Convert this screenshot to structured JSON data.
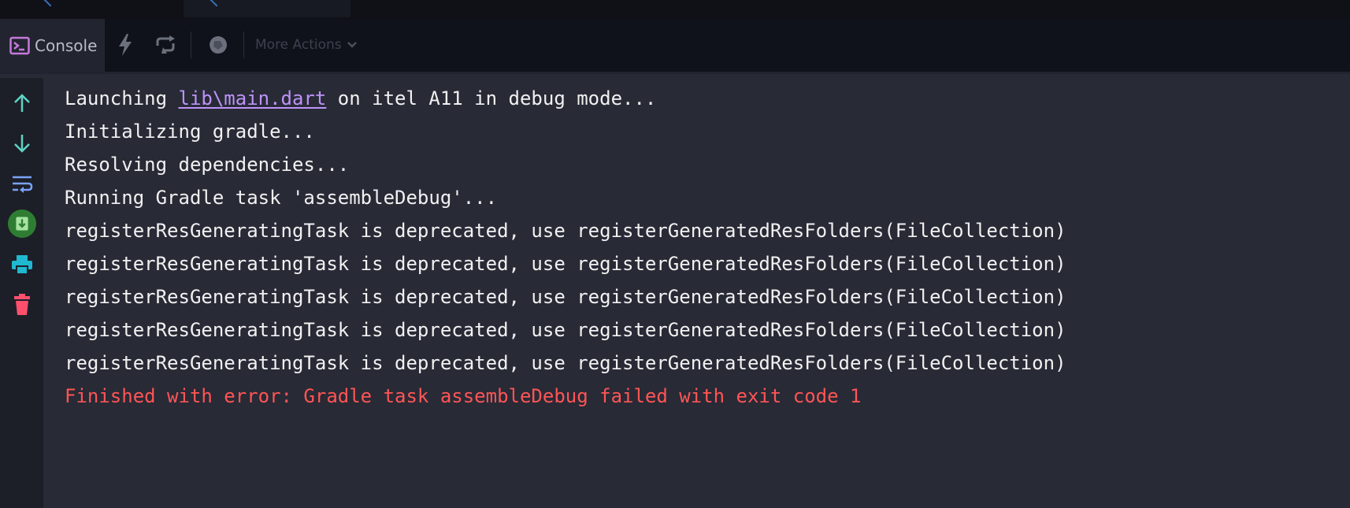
{
  "toolbar": {
    "console_label": "Console",
    "more_actions_label": "More Actions"
  },
  "console": {
    "line1_prefix": "Launching ",
    "line1_link": "lib\\main.dart",
    "line1_suffix": " on itel A11 in debug mode...",
    "lines": [
      "Initializing gradle...",
      "Resolving dependencies...",
      "Running Gradle task 'assembleDebug'...",
      "registerResGeneratingTask is deprecated, use registerGeneratedResFolders(FileCollection)",
      "registerResGeneratingTask is deprecated, use registerGeneratedResFolders(FileCollection)",
      "registerResGeneratingTask is deprecated, use registerGeneratedResFolders(FileCollection)",
      "registerResGeneratingTask is deprecated, use registerGeneratedResFolders(FileCollection)",
      "registerResGeneratingTask is deprecated, use registerGeneratedResFolders(FileCollection)"
    ],
    "error_line": "Finished with error: Gradle task assembleDebug failed with exit code 1"
  },
  "colors": {
    "background": "#282a36",
    "text": "#f1f1f1",
    "link": "#bd93f9",
    "error": "#ff5555",
    "accent_green": "#50a14f",
    "accent_teal": "#5fd3c5",
    "accent_red": "#ff4f6d"
  },
  "icons": {
    "console": "console-icon",
    "run": "lightning-icon",
    "rerun": "rerun-icon",
    "debug": "bug-icon",
    "scroll_up": "arrow-up-icon",
    "scroll_down": "arrow-down-icon",
    "wrap": "soft-wrap-icon",
    "scroll_end": "scroll-to-end-icon",
    "print": "print-icon",
    "clear": "trash-icon"
  }
}
